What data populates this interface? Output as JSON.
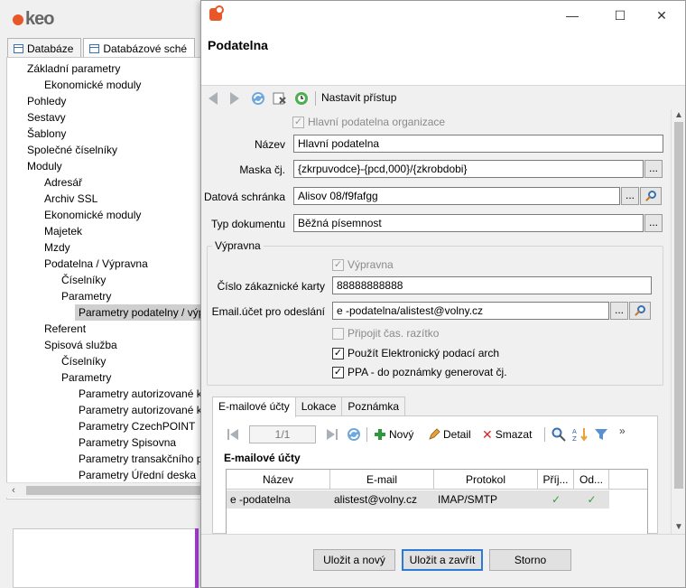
{
  "app": {
    "logo": "keo",
    "tabs": [
      {
        "label": "Databáze"
      },
      {
        "label": "Databázové sché"
      }
    ],
    "tree": [
      {
        "label": "Základní parametry"
      },
      {
        "label": "Ekonomické moduly"
      },
      {
        "label": "Pohledy"
      },
      {
        "label": "Sestavy"
      },
      {
        "label": "Šablony"
      },
      {
        "label": "Společné číselníky"
      },
      {
        "label": "Moduly"
      },
      {
        "label": "Adresář"
      },
      {
        "label": "Archiv SSL"
      },
      {
        "label": "Ekonomické moduly"
      },
      {
        "label": "Majetek"
      },
      {
        "label": "Mzdy"
      },
      {
        "label": "Podatelna / Výpravna"
      },
      {
        "label": "Číselníky"
      },
      {
        "label": "Parametry"
      },
      {
        "label": "Parametry podatelny / výp"
      },
      {
        "label": "Referent"
      },
      {
        "label": "Spisová služba"
      },
      {
        "label": "Číselníky"
      },
      {
        "label": "Parametry"
      },
      {
        "label": "Parametry autorizované ko"
      },
      {
        "label": "Parametry autorizované ko"
      },
      {
        "label": "Parametry CzechPOINT"
      },
      {
        "label": "Parametry Spisovna"
      },
      {
        "label": "Parametry transakčního p"
      },
      {
        "label": "Parametry Úřední deska"
      }
    ]
  },
  "dialog": {
    "title": "Podatelna",
    "toolbar": {
      "access_label": "Nastavit přístup"
    },
    "form": {
      "main_org_label": "Hlavní podatelna organizace",
      "name_label": "Název",
      "name_value": "Hlavní podatelna",
      "mask_label": "Maska čj.",
      "mask_value": "{zkrpuvodce}-{pcd,000}/{zkrobdobi}",
      "databox_label": "Datová schránka",
      "databox_value": "Alisov 08/f9fafgg",
      "doctype_label": "Typ dokumentu",
      "doctype_value": "Běžná písemnost",
      "dots": "..."
    },
    "vypravna": {
      "group_title": "Výpravna",
      "enabled_label": "Výpravna",
      "card_label": "Číslo zákaznické karty",
      "card_value": "88888888888",
      "email_label": "Email.účet pro odeslání",
      "email_value": "e -podatelna/alistest@volny.cz",
      "stamp_label": "Připojit čas. razítko",
      "e_arch_label": "Použít Elektronický podací arch",
      "ppa_label": "PPA - do poznámky generovat čj."
    },
    "tabs": [
      {
        "label": "E-mailové účty"
      },
      {
        "label": "Lokace"
      },
      {
        "label": "Poznámka"
      }
    ],
    "subtoolbar": {
      "pager": "1/1",
      "new_label": "Nový",
      "detail_label": "Detail",
      "delete_label": "Smazat",
      "more": "»"
    },
    "accounts": {
      "section_title": "E-mailové účty",
      "columns": [
        "Název",
        "E-mail",
        "Protokol",
        "Příj...",
        "Od..."
      ],
      "rows": [
        {
          "name": "e -podatelna",
          "email": "alistest@volny.cz",
          "protocol": "IMAP/SMTP",
          "receive": "✓",
          "send": "✓"
        }
      ]
    },
    "buttons": {
      "save_new": "Uložit a nový",
      "save_close": "Uložit a zavřít",
      "cancel": "Storno"
    },
    "window_controls": {
      "minimize": "—",
      "maximize": "☐",
      "close": "✕"
    }
  },
  "colors": {
    "accent": "#2c7ad6",
    "brand": "#e8572a",
    "check_green": "#3c9a3c",
    "purple_strip": "#a23ccf"
  }
}
